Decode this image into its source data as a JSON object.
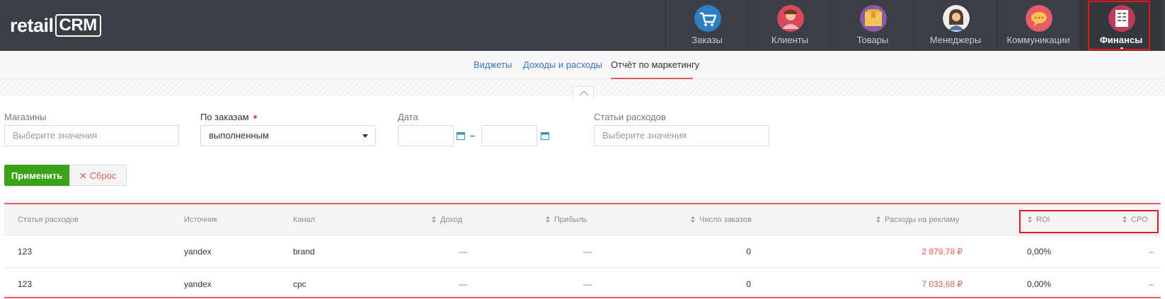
{
  "header": {
    "logo_main": "retail",
    "logo_crm": "CRM",
    "nav": [
      {
        "label": "Заказы",
        "icon": "cart-icon",
        "color": "#2d7fc1"
      },
      {
        "label": "Клиенты",
        "icon": "client-icon",
        "color": "#e65b6a"
      },
      {
        "label": "Товары",
        "icon": "box-icon",
        "color": "#8a5aa8"
      },
      {
        "label": "Менеджеры",
        "icon": "manager-icon",
        "color": "#e0e0e0"
      },
      {
        "label": "Коммуникации",
        "icon": "chat-icon",
        "color": "#e65b6a"
      },
      {
        "label": "Финансы",
        "icon": "finance-icon",
        "color": "#c0395a",
        "active": true
      }
    ]
  },
  "subnav": {
    "tabs": [
      "Виджеты",
      "Доходы и расходы",
      "Отчёт по маркетингу"
    ],
    "active_index": 2
  },
  "filters": {
    "shops_label": "Магазины",
    "shops_placeholder": "Выберите значения",
    "orders_label": "По заказам",
    "orders_value": "выполненным",
    "date_label": "Дата",
    "date_separator": "–",
    "expense_label": "Статьи расходов",
    "expense_placeholder": "Выберите значения",
    "apply_label": "Применить",
    "reset_label": "Сброс"
  },
  "table": {
    "columns": [
      "Статья расходов",
      "Источник",
      "Канал",
      "Доход",
      "Прибыль",
      "Число заказов",
      "Расходы на рекламу",
      "ROI",
      "CPO"
    ],
    "rows": [
      [
        "123",
        "yandex",
        "brand",
        "—",
        "—",
        "0",
        "2 879,78 ₽",
        "0,00%",
        "–"
      ],
      [
        "123",
        "yandex",
        "cpc",
        "—",
        "—",
        "0",
        "7 033,68 ₽",
        "0,00%",
        "–"
      ]
    ]
  },
  "colors": {
    "accent_red": "#e25a5a",
    "apply_green": "#3aa319",
    "header_bg": "#3a3f45",
    "link_blue": "#3b76b7"
  }
}
